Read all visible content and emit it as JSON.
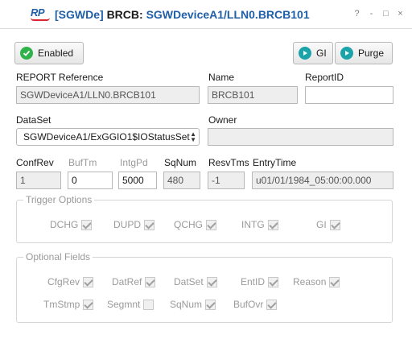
{
  "window": {
    "logo_text": "RP",
    "device_tag": "[SGWDe]",
    "title_prefix": "BRCB:",
    "title_path": "SGWDeviceA1/LLN0.BRCB101",
    "controls": [
      "?",
      "-",
      "□",
      "×"
    ]
  },
  "toolbar": {
    "enabled_label": "Enabled",
    "gi_label": "GI",
    "purge_label": "Purge"
  },
  "report": {
    "reference_label": "REPORT Reference",
    "reference_value": "SGWDeviceA1/LLN0.BRCB101",
    "name_label": "Name",
    "name_value": "BRCB101",
    "reportid_label": "ReportID",
    "reportid_value": "",
    "dataset_label": "DataSet",
    "dataset_value": "SGWDeviceA1/ExGGIO1$IOStatusSet",
    "owner_label": "Owner",
    "owner_value": ""
  },
  "params": {
    "confrev_label": "ConfRev",
    "confrev_value": "1",
    "buftm_label": "BufTm",
    "buftm_value": "0",
    "intgpd_label": "IntgPd",
    "intgpd_value": "5000",
    "sqnum_label": "SqNum",
    "sqnum_value": "480",
    "resvtms_label": "ResvTms",
    "resvtms_value": "-1",
    "entrytime_label": "EntryTime",
    "entrytime_value": "u01/01/1984_05:00:00.000"
  },
  "trigger_options": {
    "legend": "Trigger Options",
    "items": [
      {
        "label": "DCHG",
        "checked": true
      },
      {
        "label": "DUPD",
        "checked": true
      },
      {
        "label": "QCHG",
        "checked": true
      },
      {
        "label": "INTG",
        "checked": true
      },
      {
        "label": "GI",
        "checked": true
      }
    ]
  },
  "optional_fields": {
    "legend": "Optional Fields",
    "items": [
      {
        "label": "CfgRev",
        "checked": true
      },
      {
        "label": "DatRef",
        "checked": true
      },
      {
        "label": "DatSet",
        "checked": true
      },
      {
        "label": "EntID",
        "checked": true
      },
      {
        "label": "Reason",
        "checked": true
      },
      {
        "label": "TmStmp",
        "checked": true
      },
      {
        "label": "Segmnt",
        "checked": false
      },
      {
        "label": "SqNum",
        "checked": true
      },
      {
        "label": "BufOvr",
        "checked": true
      }
    ]
  },
  "colors": {
    "accent": "#1f5fa8",
    "logo_red": "#d9262c",
    "enabled_green": "#2fb24a",
    "action_teal": "#1aa3a8"
  }
}
